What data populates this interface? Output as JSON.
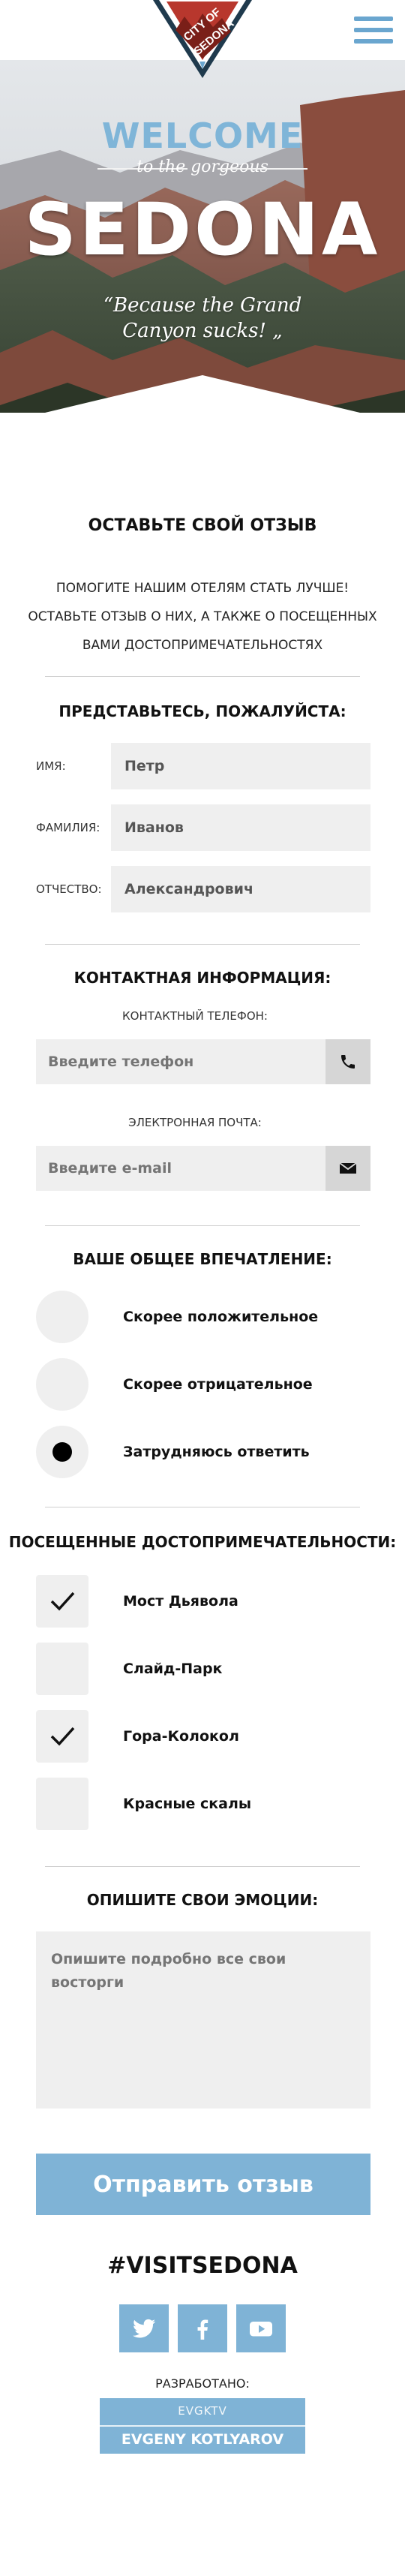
{
  "colors": {
    "accent": "#7fb3d6",
    "accent_dark": "#6aa6cf",
    "field_bg": "#efefef",
    "icon_bg": "#d6d6d6",
    "logo_red": "#b8372d"
  },
  "header": {
    "logo_text_top": "CITY OF",
    "logo_text_bottom": "SEDONA",
    "menu_icon": "hamburger-icon"
  },
  "hero": {
    "welcome": "WELCOME",
    "gorgeous": "to the gorgeous",
    "title": "SEDONA",
    "quote_line1": "“Because the Grand",
    "quote_line2": "Canyon sucks! „"
  },
  "review": {
    "title": "ОСТАВЬТЕ СВОЙ ОТЗЫВ",
    "intro_line1": "ПОМОГИТЕ НАШИМ ОТЕЛЯМ СТАТЬ ЛУЧШЕ!",
    "intro_line2": "ОСТАВЬТЕ ОТЗЫВ О НИХ, А ТАКЖЕ О ПОСЕЩЕННЫХ",
    "intro_line3": "ВАМИ ДОСТОПРИМЕЧАТЕЛЬНОСТЯХ"
  },
  "identity": {
    "title": "ПРЕДСТАВЬТЕСЬ, ПОЖАЛУЙСТА:",
    "first_name_label": "ИМЯ:",
    "first_name_value": "Петр",
    "last_name_label": "ФАМИЛИЯ:",
    "last_name_value": "Иванов",
    "patronymic_label": "ОТЧЕСТВО:",
    "patronymic_value": "Александрович"
  },
  "contacts": {
    "title": "КОНТАКТНАЯ ИНФОРМАЦИЯ:",
    "phone_label": "КОНТАКТНЫЙ ТЕЛЕФОН:",
    "phone_placeholder": "Введите телефон",
    "phone_icon": "phone-icon",
    "email_label": "ЭЛЕКТРОННАЯ ПОЧТА:",
    "email_placeholder": "Введите e-mail",
    "email_icon": "envelope-icon"
  },
  "impression": {
    "title": "ВАШЕ ОБЩЕЕ ВПЕЧАТЛЕНИЕ:",
    "options": [
      {
        "label": "Скорее положительное",
        "selected": false
      },
      {
        "label": "Скорее отрицательное",
        "selected": false
      },
      {
        "label": "Затрудняюсь ответить",
        "selected": true
      }
    ]
  },
  "sights": {
    "title": "ПОСЕЩЕННЫЕ ДОСТОПРИМЕЧАТЕЛЬНОСТИ:",
    "options": [
      {
        "label": "Мост Дьявола",
        "checked": true
      },
      {
        "label": "Слайд-Парк",
        "checked": false
      },
      {
        "label": "Гора-Колокол",
        "checked": true
      },
      {
        "label": "Красные скалы",
        "checked": false
      }
    ]
  },
  "emotions": {
    "title": "ОПИШИТЕ СВОИ ЭМОЦИИ:",
    "placeholder": "Опишите подробно все свои восторги"
  },
  "submit_label": "Отправить отзыв",
  "footer": {
    "hashtag": "#VISITSEDONA",
    "socials": [
      "twitter-icon",
      "facebook-icon",
      "youtube-icon"
    ],
    "developed_label": "РАЗРАБОТАНО:",
    "dev_tag": "EVGKTV",
    "dev_name": "EVGENY KOTLYAROV"
  }
}
